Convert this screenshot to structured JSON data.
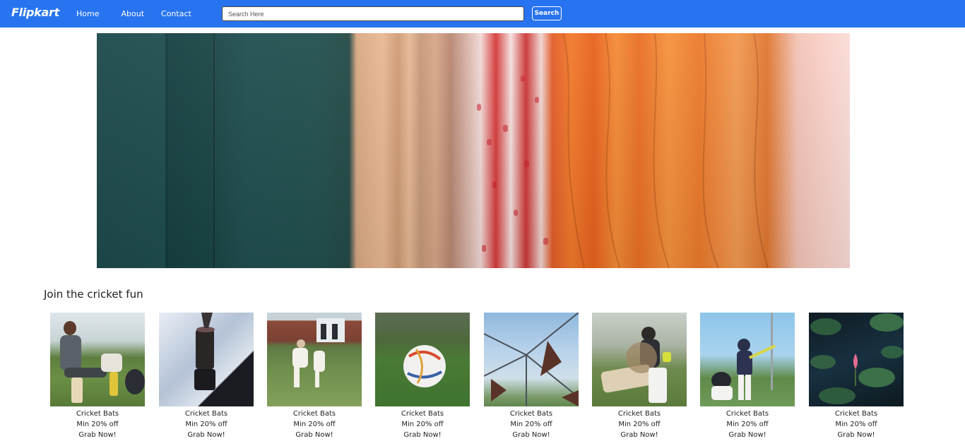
{
  "header": {
    "logo": "Flipkart",
    "nav": [
      {
        "label": "Home"
      },
      {
        "label": "About"
      },
      {
        "label": "Contact"
      }
    ],
    "search": {
      "placeholder": "Search Here",
      "value": ""
    },
    "search_button": "Search",
    "accent": "#2874f0"
  },
  "section": {
    "title": "Join the cricket fun",
    "products": [
      {
        "name": "Cricket Bats",
        "offer": "Min 20% off",
        "cta": "Grab Now!"
      },
      {
        "name": "Cricket Bats",
        "offer": "Min 20% off",
        "cta": "Grab Now!"
      },
      {
        "name": "Cricket Bats",
        "offer": "Min 20% off",
        "cta": "Grab Now!"
      },
      {
        "name": "Cricket Bats",
        "offer": "Min 20% off",
        "cta": "Grab Now!"
      },
      {
        "name": "Cricket Bats",
        "offer": "Min 20% off",
        "cta": "Grab Now!"
      },
      {
        "name": "Cricket Bats",
        "offer": "Min 20% off",
        "cta": "Grab Now!"
      },
      {
        "name": "Cricket Bats",
        "offer": "Min 20% off",
        "cta": "Grab Now!"
      },
      {
        "name": "Cricket Bats",
        "offer": "Min 20% off",
        "cta": "Grab Now!"
      }
    ]
  }
}
